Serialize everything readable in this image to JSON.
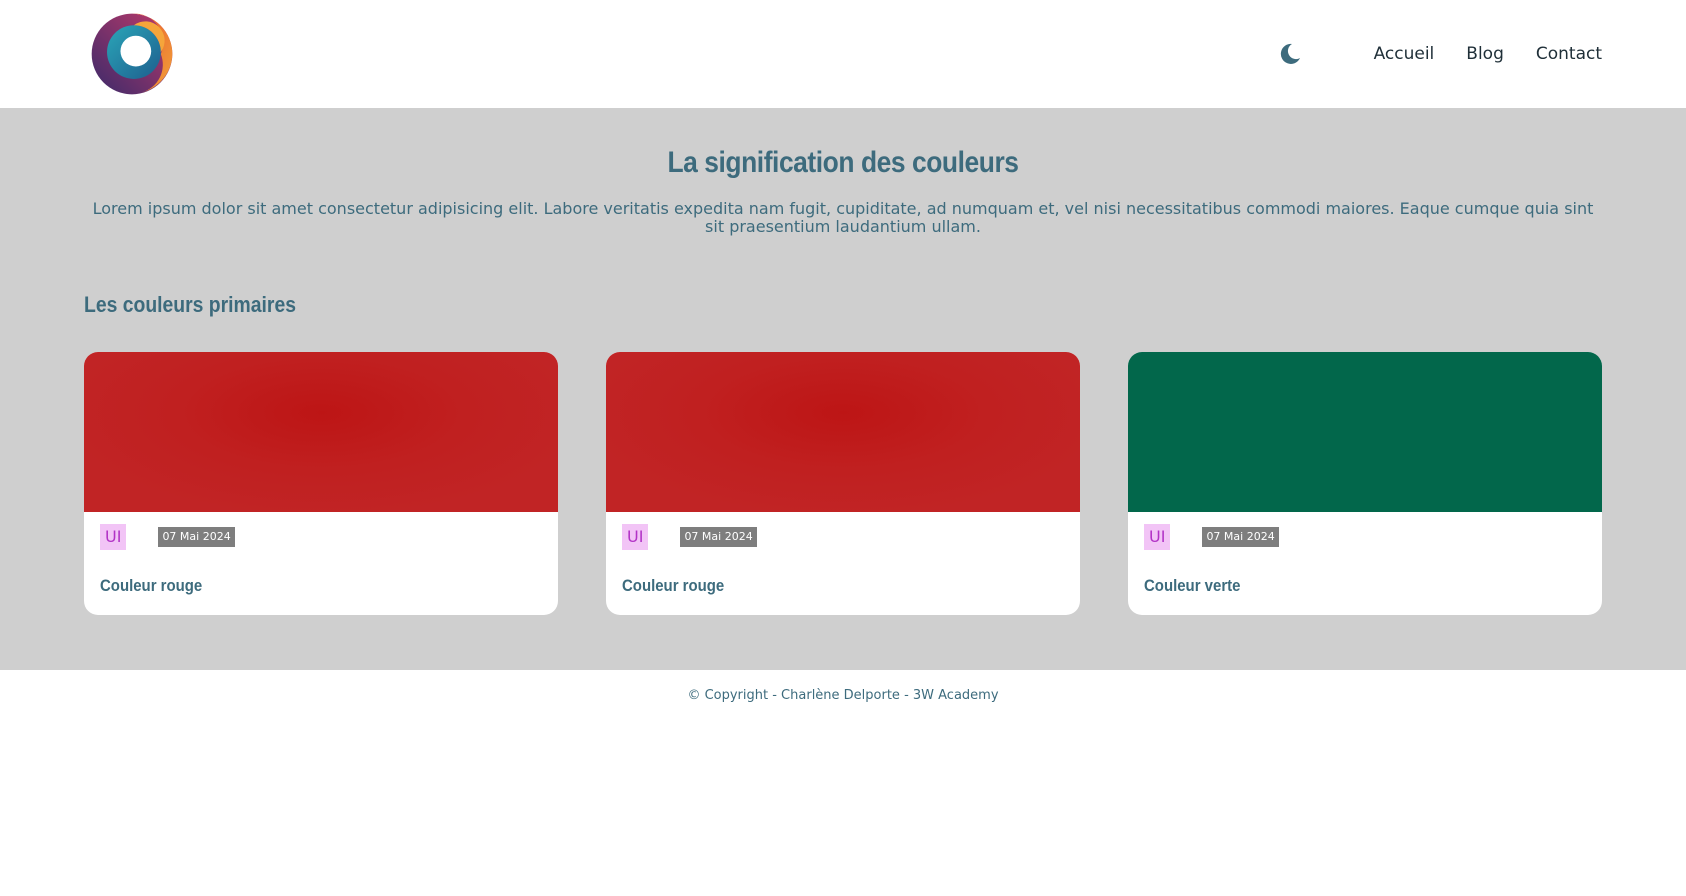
{
  "header": {
    "logo_icon": "swirl-logo-icon",
    "theme_toggle_icon": "moon-icon",
    "nav": [
      {
        "label": "Accueil"
      },
      {
        "label": "Blog"
      },
      {
        "label": "Contact"
      }
    ]
  },
  "main": {
    "title": "La signification des couleurs",
    "intro": "Lorem ipsum dolor sit amet consectetur adipisicing elit. Labore veritatis expedita nam fugit, cupiditate, ad numquam et, vel nisi necessitatibus commodi maiores. Eaque cumque quia sint sit praesentium laudantium ullam.",
    "section_title": "Les couleurs primaires",
    "cards": [
      {
        "tag": "UI",
        "date": "07 Mai 2024",
        "title": "Couleur rouge",
        "image_color": "#c0201f"
      },
      {
        "tag": "UI",
        "date": "07 Mai 2024",
        "title": "Couleur rouge",
        "image_color": "#c0201f"
      },
      {
        "tag": "UI",
        "date": "07 Mai 2024",
        "title": "Couleur verte",
        "image_color": "#02674b"
      }
    ]
  },
  "footer": {
    "copyright": "© Copyright - Charlène Delporte - 3W Academy"
  },
  "colors": {
    "accent": "#3d6b7d",
    "page_background": "#cfcfcf",
    "tag_background": "#f2c4f6",
    "tag_text": "#b233c6",
    "date_background": "#7e7e7e"
  }
}
